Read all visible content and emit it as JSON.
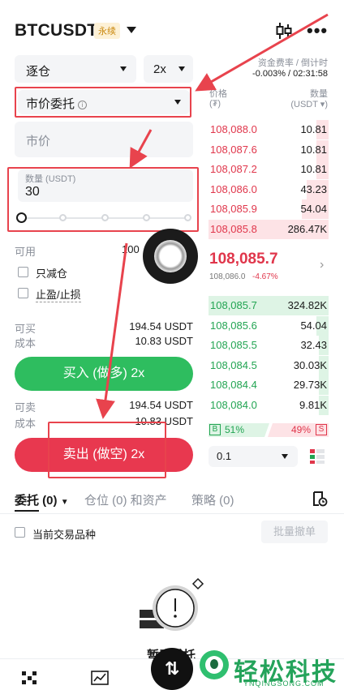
{
  "header": {
    "symbol": "BTCUSDT",
    "badge": "永续"
  },
  "funding": {
    "label": "资金费率 / 倒计时",
    "value": "-0.003% / 02:31:58"
  },
  "form": {
    "margin_mode": "逐仓",
    "leverage": "2x",
    "order_type": "市价委托",
    "price_field": "市价",
    "qty_label": "数量 (USDT)",
    "qty_value": "30",
    "slider_level_percent": 0,
    "available_label": "可用",
    "available_value": "100",
    "reduce_only": "只减仓",
    "tp_sl": "止盈/止损",
    "buy_max_label": "可买",
    "buy_max_value": "194.54 USDT",
    "buy_cost_label": "成本",
    "buy_cost_value": "10.83 USDT",
    "buy_button": "买入 (做多) 2x",
    "sell_max_label": "可卖",
    "sell_max_value": "194.54 USDT",
    "sell_cost_label": "成本",
    "sell_cost_value": "10.83 USDT",
    "sell_button": "卖出 (做空) 2x"
  },
  "orderbook": {
    "price_header": "价格",
    "price_unit": "(₮)",
    "qty_header": "数量",
    "qty_unit": "(USDT ▾)",
    "asks": [
      {
        "price": "108,088.0",
        "qty": "10.81",
        "depth": 0.1
      },
      {
        "price": "108,087.6",
        "qty": "10.81",
        "depth": 0.1
      },
      {
        "price": "108,087.2",
        "qty": "10.81",
        "depth": 0.1
      },
      {
        "price": "108,086.0",
        "qty": "43.23",
        "depth": 0.18
      },
      {
        "price": "108,085.9",
        "qty": "54.04",
        "depth": 0.22
      },
      {
        "price": "108,085.8",
        "qty": "286.47K",
        "depth": 1.0
      }
    ],
    "last_price": "108,085.7",
    "mark_price": "108,086.0",
    "change": "-4.67%",
    "bids": [
      {
        "price": "108,085.7",
        "qty": "324.82K",
        "depth": 1.0
      },
      {
        "price": "108,085.6",
        "qty": "54.04",
        "depth": 0.1
      },
      {
        "price": "108,085.5",
        "qty": "32.43",
        "depth": 0.08
      },
      {
        "price": "108,084.5",
        "qty": "30.03K",
        "depth": 0.08
      },
      {
        "price": "108,084.4",
        "qty": "29.73K",
        "depth": 0.08
      },
      {
        "price": "108,084.0",
        "qty": "9.81K",
        "depth": 0.08
      }
    ],
    "buy_ratio_label": "B",
    "buy_ratio": "51%",
    "sell_ratio": "49%",
    "sell_ratio_label": "S",
    "precision": "0.1"
  },
  "tabs": {
    "orders": "委托 (0)",
    "positions": "仓位 (0) 和资产",
    "strategy": "策略 (0)"
  },
  "filter": {
    "current_only": "当前交易品种",
    "cancel_all": "批量撤单"
  },
  "empty": {
    "label": "暂无委托"
  },
  "watermark": {
    "cn": "轻松科技",
    "url": "YNQINGSONG.COM"
  },
  "colors": {
    "buy": "#2ebd5f",
    "sell": "#e8384f",
    "annotation": "#e8434d"
  }
}
